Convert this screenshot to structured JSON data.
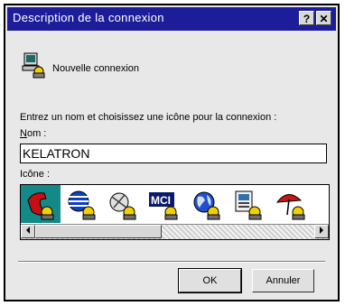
{
  "window": {
    "title": "Description de la connexion",
    "help_button": "?",
    "close_button": "✕"
  },
  "header": {
    "icon": "network-computer-icon",
    "label": "Nouvelle connexion"
  },
  "form": {
    "instructions": "Entrez un nom et choisissez une icône pour la connexion :",
    "name_label_accesskey": "N",
    "name_label_rest": "om :",
    "name_value": "KELATRON",
    "icon_label": "Icône :"
  },
  "icons": [
    {
      "name": "red-phone-icon",
      "selected": true
    },
    {
      "name": "att-globe-icon",
      "selected": false
    },
    {
      "name": "satellite-globe-icon",
      "selected": false
    },
    {
      "name": "mci-logo-icon",
      "selected": false
    },
    {
      "name": "blue-globe-icon",
      "selected": false
    },
    {
      "name": "document-files-icon",
      "selected": false
    },
    {
      "name": "umbrella-icon",
      "selected": false
    }
  ],
  "scrollbar": {
    "position": 0
  },
  "buttons": {
    "ok": "OK",
    "cancel": "Annuler"
  },
  "colors": {
    "title_bar": "#1d1d9a",
    "selection": "#138a88",
    "dialog_bg": "#e8e8e8"
  }
}
